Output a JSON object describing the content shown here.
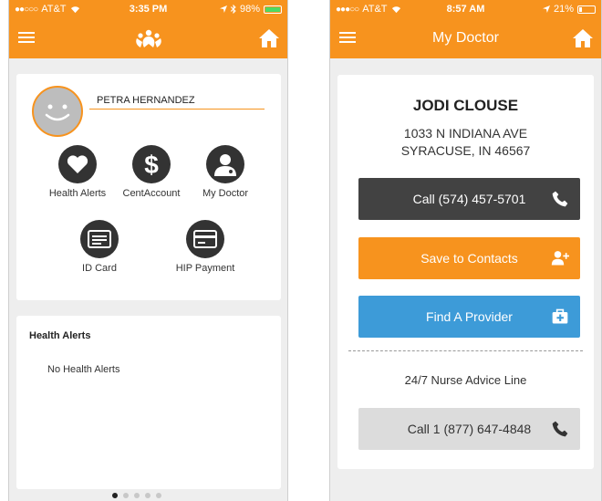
{
  "left_screen": {
    "status": {
      "carrier": "AT&T",
      "time": "3:35 PM",
      "battery": "98%"
    },
    "profile": {
      "member_name": "PETRA HERNANDEZ"
    },
    "tiles": [
      {
        "label": "Health Alerts",
        "icon": "heart-icon"
      },
      {
        "label": "CentAccount",
        "icon": "dollar-icon"
      },
      {
        "label": "My Doctor",
        "icon": "doctor-icon"
      },
      {
        "label": "ID Card",
        "icon": "id-card-icon"
      },
      {
        "label": "HIP Payment",
        "icon": "credit-card-icon"
      }
    ],
    "alerts": {
      "heading": "Health Alerts",
      "empty_text": "No Health Alerts"
    },
    "pager": {
      "count": 5,
      "active": 0
    }
  },
  "right_screen": {
    "status": {
      "carrier": "AT&T",
      "time": "8:57 AM",
      "battery": "21%"
    },
    "nav_title": "My Doctor",
    "doctor": {
      "name": "JODI CLOUSE",
      "address_line1": "1033 N INDIANA AVE",
      "address_line2": "SYRACUSE, IN 46567"
    },
    "buttons": {
      "call_doctor": "Call (574) 457-5701",
      "save_contacts": "Save to Contacts",
      "find_provider": "Find A Provider",
      "call_nurse": "Call 1 (877) 647-4848"
    },
    "nurse_line_label": "24/7 Nurse Advice Line"
  },
  "colors": {
    "brand_orange": "#f7931e",
    "dark_button": "#424242",
    "blue_button": "#3d9bd8",
    "gray_button": "#dcdcdc",
    "icon_circle": "#333333"
  }
}
